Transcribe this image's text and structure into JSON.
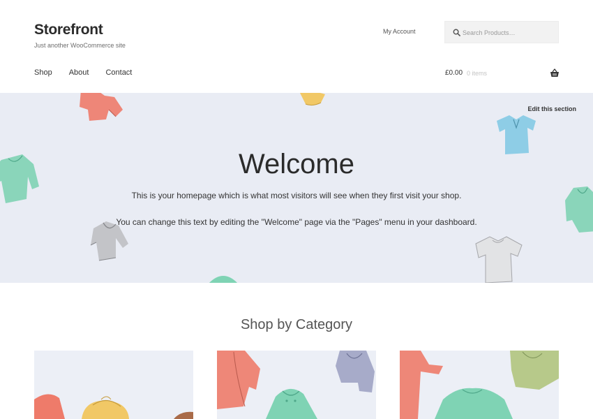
{
  "header": {
    "site_title": "Storefront",
    "tagline": "Just another WooCommerce site",
    "my_account": "My Account",
    "search": {
      "placeholder": "Search Products…",
      "value": ""
    }
  },
  "nav": {
    "items": [
      {
        "label": "Shop"
      },
      {
        "label": "About"
      },
      {
        "label": "Contact"
      }
    ]
  },
  "cart": {
    "total": "£0.00",
    "count": "0 items"
  },
  "hero": {
    "edit_label": "Edit this section",
    "title": "Welcome",
    "paragraph_1": "This is your homepage which is what most visitors will see when they first visit your shop.",
    "paragraph_2": "You can change this text by editing the \"Welcome\" page via the \"Pages\" menu in your dashboard."
  },
  "shop_by_category": {
    "title": "Shop by Category"
  },
  "icons": {
    "search": "search-icon",
    "cart": "basket-icon"
  },
  "colors": {
    "hero_background": "#e9ecf4",
    "coral": "#ee7b6a",
    "mint": "#7fd3b4",
    "sky": "#8ecde6",
    "gray": "#bfc0c4",
    "mustard": "#f1c866",
    "olive": "#b7c98a",
    "lilac": "#a7abc9"
  }
}
